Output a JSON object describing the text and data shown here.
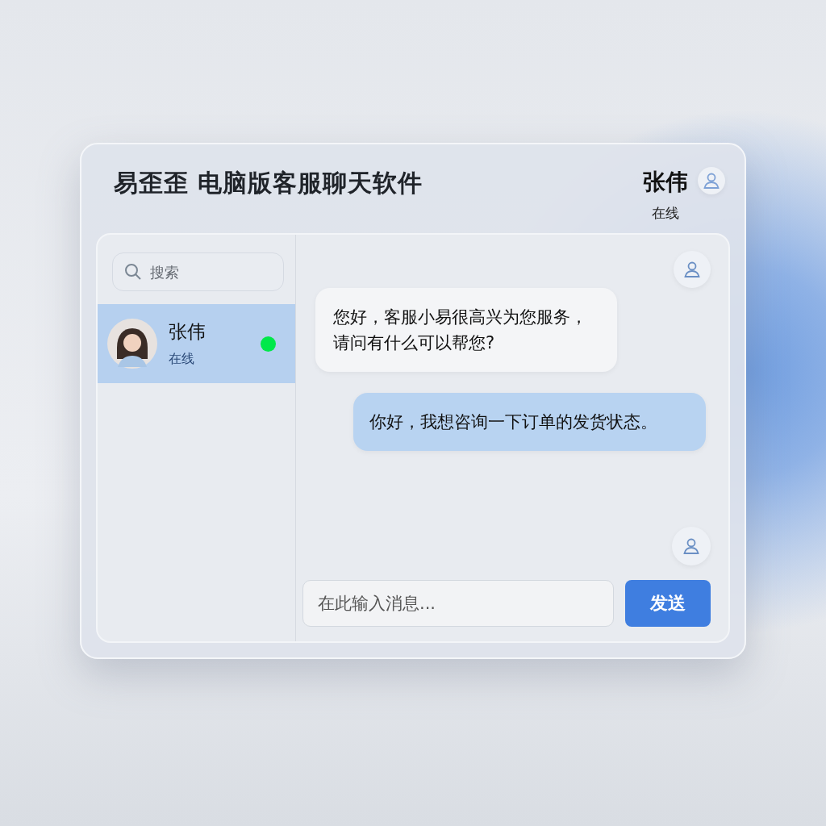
{
  "header": {
    "title": "易歪歪 电脑版客服聊天软件",
    "contact_name": "张伟",
    "contact_status": "在线"
  },
  "sidebar": {
    "search": {
      "placeholder": "搜索"
    },
    "contacts": [
      {
        "name": "张伟",
        "status": "在线",
        "selected": true,
        "color": "#00e84a"
      }
    ]
  },
  "messages": [
    {
      "kind": "incoming",
      "text": "您好，客服小易很高兴为您服务，请问有什么可以帮您?"
    },
    {
      "kind": "outgoing",
      "text": "你好，我想咨询一下订单的发货状态。"
    }
  ],
  "composer": {
    "placeholder": "在此输入消息...",
    "send_label": "发送"
  }
}
